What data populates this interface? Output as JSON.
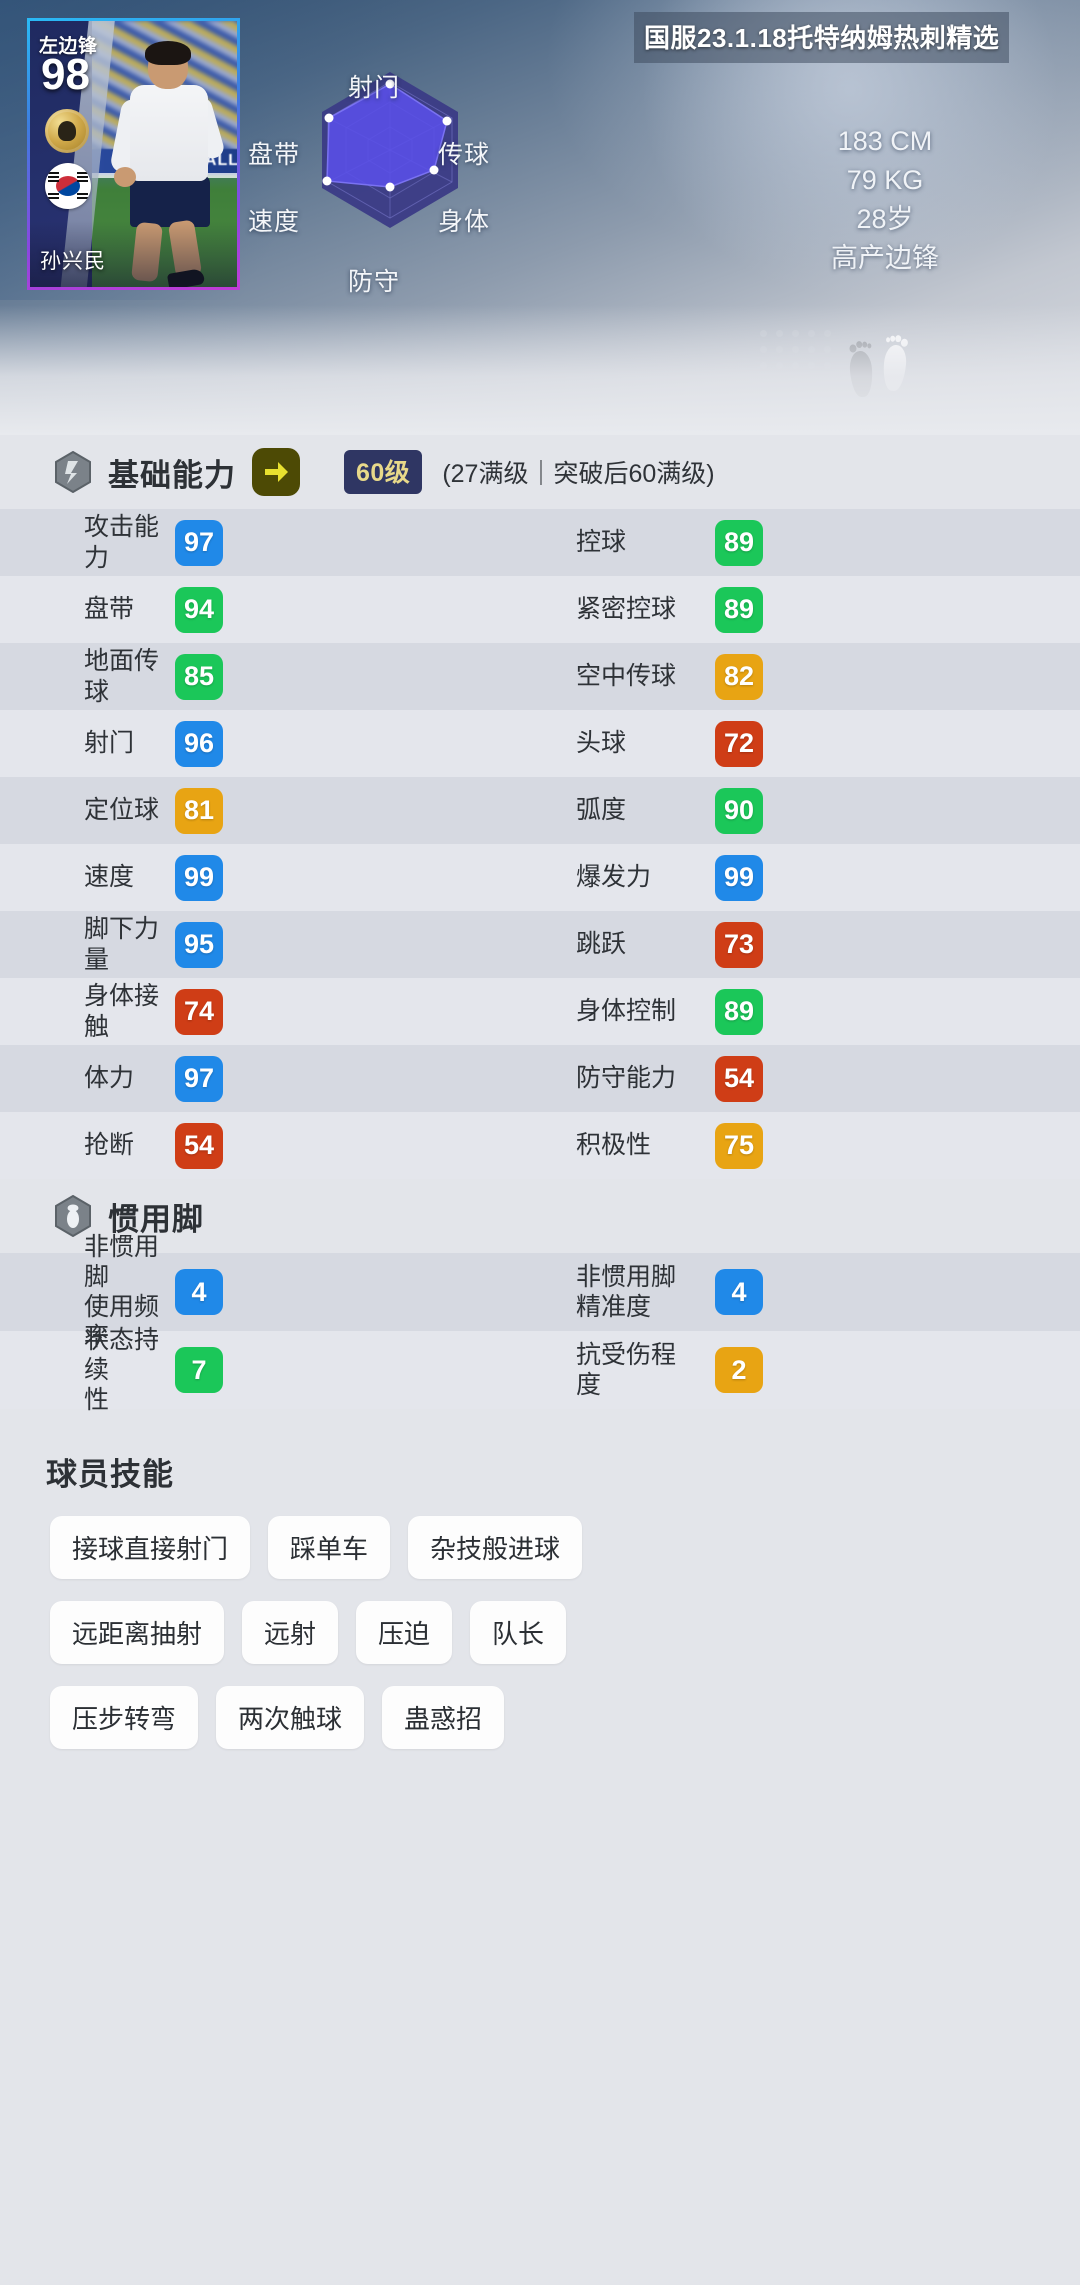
{
  "hero": {
    "title": "国服23.1.18托特纳姆热刺精选",
    "card": {
      "position": "左边锋",
      "rating": "98",
      "name": "孙兴民",
      "emblem_icon": "club-emblem-icon",
      "flag_icon": "south-korea-flag-icon"
    },
    "meta": {
      "height": "183 CM",
      "weight": "79 KG",
      "age": "28岁",
      "playstyle": "高产边锋"
    },
    "feet_icon": "footprints-icon"
  },
  "chart_data": {
    "type": "radar",
    "title": "",
    "categories": [
      "射门",
      "传球",
      "身体",
      "防守",
      "速度",
      "盘带"
    ],
    "values": [
      96,
      89,
      74,
      54,
      99,
      94
    ],
    "max": 100,
    "labels": {
      "shooting": "射门",
      "passing": "传球",
      "physical": "身体",
      "defending": "防守",
      "speed": "速度",
      "dribbling": "盘带"
    },
    "grid": true,
    "legend": "none"
  },
  "base_section": {
    "icon": "ability-hex-icon",
    "title": "基础能力",
    "arrow_icon": "arrow-right-icon",
    "level_badge": "60级",
    "level_note": "(27满级｜突破后60满级)",
    "rows": [
      {
        "left_label": "攻击能力",
        "left_value": "97",
        "left_color": "blue",
        "right_label": "控球",
        "right_value": "89",
        "right_color": "green"
      },
      {
        "left_label": "盘带",
        "left_value": "94",
        "left_color": "green",
        "right_label": "紧密控球",
        "right_value": "89",
        "right_color": "green"
      },
      {
        "left_label": "地面传球",
        "left_value": "85",
        "left_color": "green",
        "right_label": "空中传球",
        "right_value": "82",
        "right_color": "orange"
      },
      {
        "left_label": "射门",
        "left_value": "96",
        "left_color": "blue",
        "right_label": "头球",
        "right_value": "72",
        "right_color": "red"
      },
      {
        "left_label": "定位球",
        "left_value": "81",
        "left_color": "orange",
        "right_label": "弧度",
        "right_value": "90",
        "right_color": "green"
      },
      {
        "left_label": "速度",
        "left_value": "99",
        "left_color": "blue",
        "right_label": "爆发力",
        "right_value": "99",
        "right_color": "blue"
      },
      {
        "left_label": "脚下力量",
        "left_value": "95",
        "left_color": "blue",
        "right_label": "跳跃",
        "right_value": "73",
        "right_color": "red"
      },
      {
        "left_label": "身体接触",
        "left_value": "74",
        "left_color": "red",
        "right_label": "身体控制",
        "right_value": "89",
        "right_color": "green"
      },
      {
        "left_label": "体力",
        "left_value": "97",
        "left_color": "blue",
        "right_label": "防守能力",
        "right_value": "54",
        "right_color": "red"
      },
      {
        "left_label": "抢断",
        "left_value": "54",
        "left_color": "red",
        "right_label": "积极性",
        "right_value": "75",
        "right_color": "orange"
      }
    ]
  },
  "foot_section": {
    "icon": "foot-hex-icon",
    "title": "惯用脚",
    "rows": [
      {
        "left_label": "非惯用脚\n使用频率",
        "left_value": "4",
        "left_color": "blue",
        "right_label": "非惯用脚\n精准度",
        "right_value": "4",
        "right_color": "blue"
      },
      {
        "left_label": "状态持续\n性",
        "left_value": "7",
        "left_color": "green",
        "right_label": "抗受伤程\n度",
        "right_value": "2",
        "right_color": "orange"
      }
    ]
  },
  "skills_section": {
    "title": "球员技能",
    "rows": [
      [
        "接球直接射门",
        "踩单车",
        "杂技般进球"
      ],
      [
        "远距离抽射",
        "远射",
        "压迫",
        "队长"
      ],
      [
        "压步转弯",
        "两次触球",
        "蛊惑招"
      ]
    ]
  }
}
